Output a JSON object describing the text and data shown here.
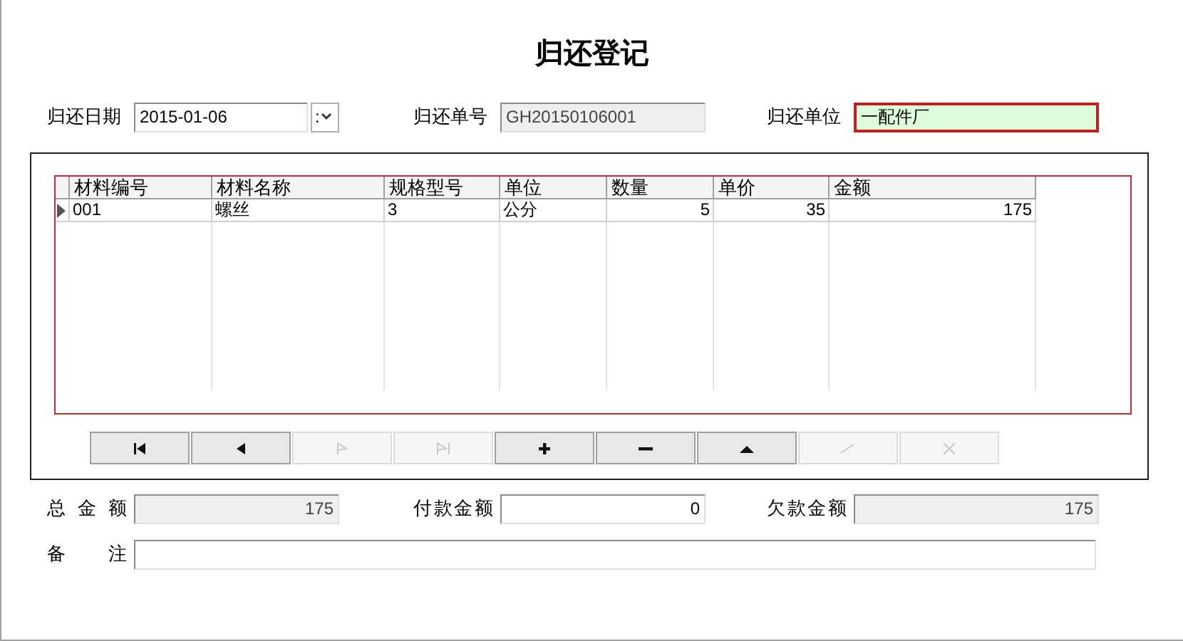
{
  "title": "归还登记",
  "header_fields": [
    {
      "label": "归还日期",
      "kind": "date",
      "value": "2015-01-06",
      "spin_text": ":",
      "readonly": false,
      "highlighted": false
    },
    {
      "label": "归还单号",
      "kind": "text",
      "value": "GH20150106001",
      "readonly": true,
      "highlighted": false
    },
    {
      "label": "归还单位",
      "kind": "text",
      "value": "一配件厂",
      "readonly": false,
      "highlighted": true
    }
  ],
  "table": {
    "columns": [
      {
        "label": "材料编号",
        "kind": "text"
      },
      {
        "label": "材料名称",
        "kind": "text"
      },
      {
        "label": "规格型号",
        "kind": "text"
      },
      {
        "label": "单位",
        "kind": "text"
      },
      {
        "label": "数量",
        "kind": "number"
      },
      {
        "label": "单价",
        "kind": "number"
      },
      {
        "label": "金额",
        "kind": "number"
      }
    ],
    "rows": [
      {
        "current": true,
        "cells": [
          "001",
          "螺丝",
          "3",
          "公分",
          "5",
          "35",
          "175"
        ]
      }
    ]
  },
  "navigator": [
    {
      "kind": "first",
      "disabled": false
    },
    {
      "kind": "prev",
      "disabled": false
    },
    {
      "kind": "next",
      "disabled": true
    },
    {
      "kind": "last",
      "disabled": true
    },
    {
      "kind": "add",
      "disabled": false
    },
    {
      "kind": "delete",
      "disabled": false
    },
    {
      "kind": "edit",
      "disabled": false
    },
    {
      "kind": "post",
      "disabled": true
    },
    {
      "kind": "cancel",
      "disabled": true
    }
  ],
  "totals": [
    {
      "label": "总 金 额",
      "value": "175",
      "readonly": true
    },
    {
      "label": "付款金额",
      "value": "0",
      "readonly": false
    },
    {
      "label": "欠款金额",
      "value": "175",
      "readonly": true
    }
  ],
  "remarks": {
    "label": "备 注"
  }
}
